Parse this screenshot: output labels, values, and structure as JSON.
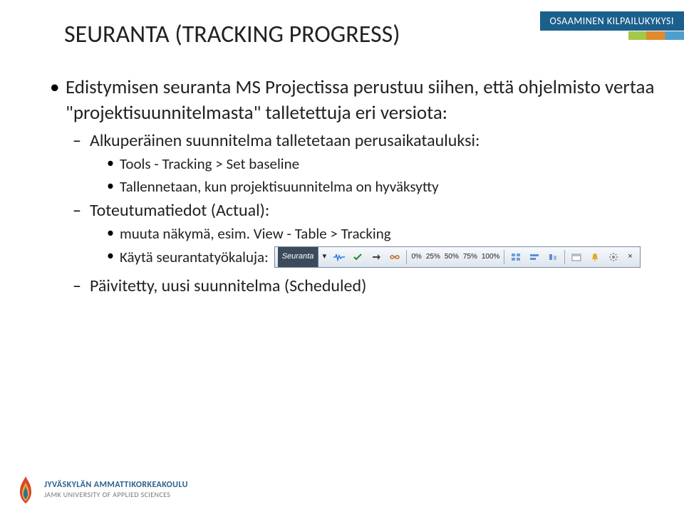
{
  "header": {
    "badge": "OSAAMINEN KILPAILUKYKYSI"
  },
  "slide": {
    "title": "SEURANTA (TRACKING PROGRESS)",
    "bullet1_part1": "Edistymisen seuranta MS Projectissa perustuu siihen, että ohjelmisto vertaa \"projektisuunnitelmasta\" talletettuja eri versiota:",
    "sub1": {
      "label": "Alkuperäinen suunnitelma talletetaan perusaikatauluksi:",
      "items": {
        "a": "Tools - Tracking > Set baseline",
        "b": "Tallennetaan, kun projektisuunnitelma on hyväksytty"
      }
    },
    "sub2": {
      "label": "Toteutumatiedot (Actual):",
      "items": {
        "a": "muuta näkymä, esim. View - Table > Tracking",
        "b": "Käytä seurantatyökaluja:"
      }
    },
    "sub3": {
      "label": "Päivitetty, uusi suunnitelma (Scheduled)"
    }
  },
  "toolbar": {
    "title": "Seuranta",
    "dropdown_glyph": "▾",
    "pcts": [
      "0%",
      "25%",
      "50%",
      "75%",
      "100%"
    ],
    "close_glyph": "×"
  },
  "footer": {
    "line1": "JYVÄSKYLÄN AMMATTIKORKEAKOULU",
    "line2": "JAMK UNIVERSITY OF APPLIED SCIENCES"
  }
}
